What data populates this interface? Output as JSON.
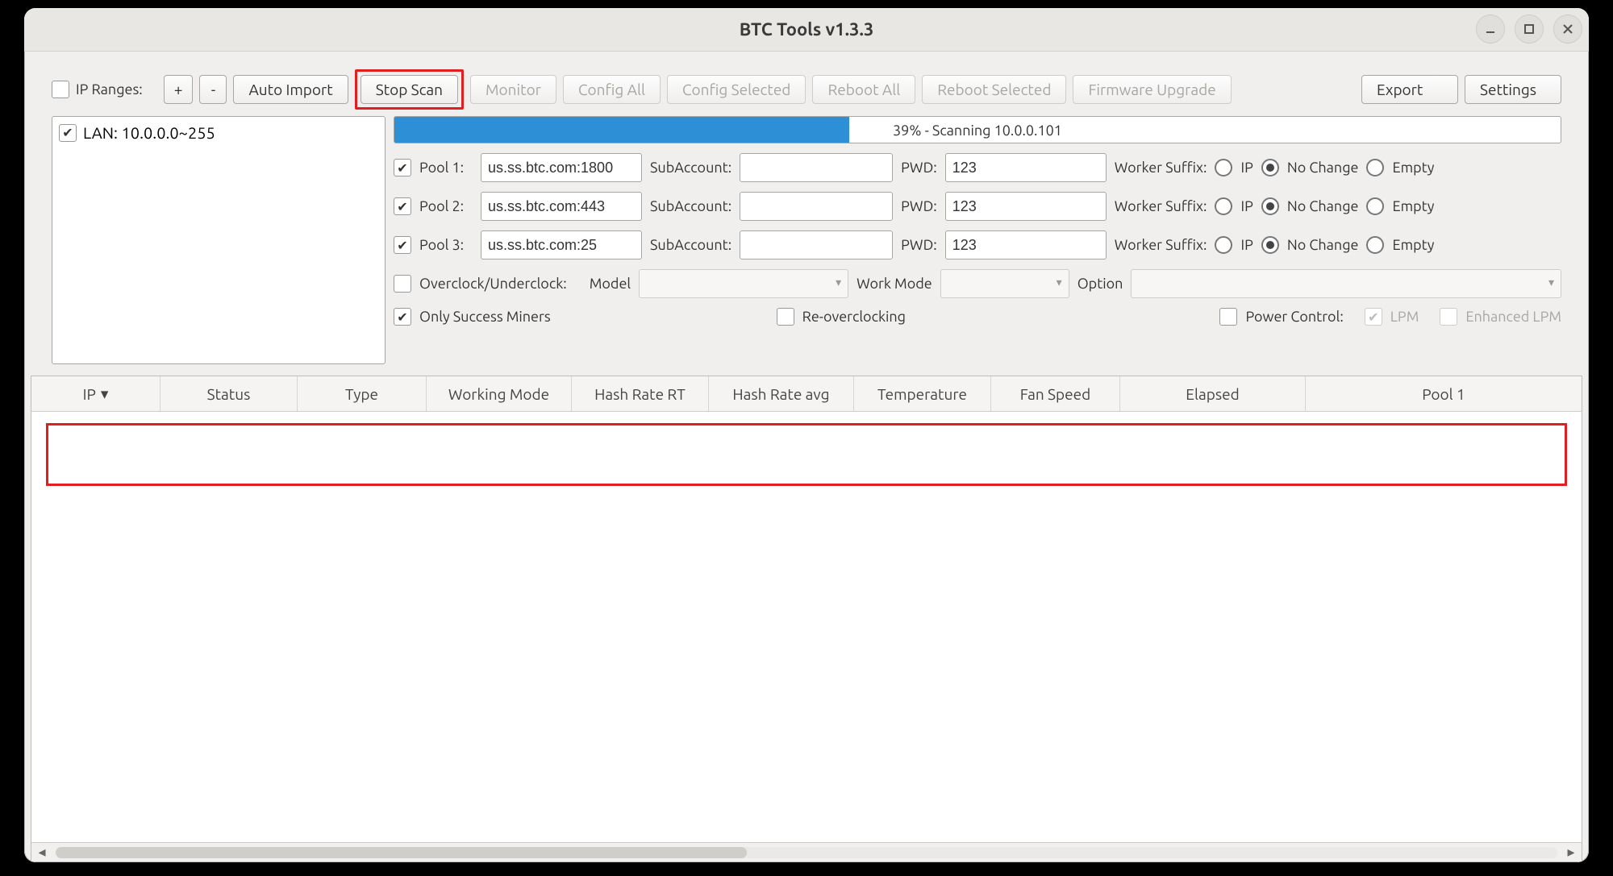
{
  "titlebar": {
    "title": "BTC Tools v1.3.3"
  },
  "toolbar": {
    "ip_ranges_label": "IP Ranges:",
    "plus": "+",
    "minus": "-",
    "auto_import": "Auto Import",
    "stop_scan": "Stop Scan",
    "monitor": "Monitor",
    "config_all": "Config All",
    "config_selected": "Config Selected",
    "reboot_all": "Reboot All",
    "reboot_selected": "Reboot Selected",
    "firmware_upgrade": "Firmware Upgrade",
    "export": "Export",
    "settings": "Settings"
  },
  "ip_list": {
    "items": [
      {
        "checked": true,
        "label": "LAN: 10.0.0.0~255"
      }
    ]
  },
  "progress": {
    "percent": 39,
    "text": "39% - Scanning 10.0.0.101"
  },
  "pools": [
    {
      "checked": true,
      "name": "Pool 1:",
      "url": "us.ss.btc.com:1800",
      "sub_label": "SubAccount:",
      "sub": "",
      "pwd_label": "PWD:",
      "pwd": "123",
      "ws_label": "Worker Suffix:",
      "ws": "No Change",
      "opts": {
        "ip": "IP",
        "nochange": "No Change",
        "empty": "Empty"
      }
    },
    {
      "checked": true,
      "name": "Pool 2:",
      "url": "us.ss.btc.com:443",
      "sub_label": "SubAccount:",
      "sub": "",
      "pwd_label": "PWD:",
      "pwd": "123",
      "ws_label": "Worker Suffix:",
      "ws": "No Change",
      "opts": {
        "ip": "IP",
        "nochange": "No Change",
        "empty": "Empty"
      }
    },
    {
      "checked": true,
      "name": "Pool 3:",
      "url": "us.ss.btc.com:25",
      "sub_label": "SubAccount:",
      "sub": "",
      "pwd_label": "PWD:",
      "pwd": "123",
      "ws_label": "Worker Suffix:",
      "ws": "No Change",
      "opts": {
        "ip": "IP",
        "nochange": "No Change",
        "empty": "Empty"
      }
    }
  ],
  "overclock": {
    "label": "Overclock/Underclock:",
    "model_label": "Model",
    "workmode_label": "Work Mode",
    "option_label": "Option"
  },
  "flags": {
    "only_success": "Only Success Miners",
    "reoverclock": "Re-overclocking",
    "power_control": "Power Control:",
    "lpm": "LPM",
    "elpm": "Enhanced LPM"
  },
  "table": {
    "columns": [
      "IP",
      "Status",
      "Type",
      "Working Mode",
      "Hash Rate RT",
      "Hash Rate avg",
      "Temperature",
      "Fan Speed",
      "Elapsed",
      "Pool 1"
    ]
  }
}
